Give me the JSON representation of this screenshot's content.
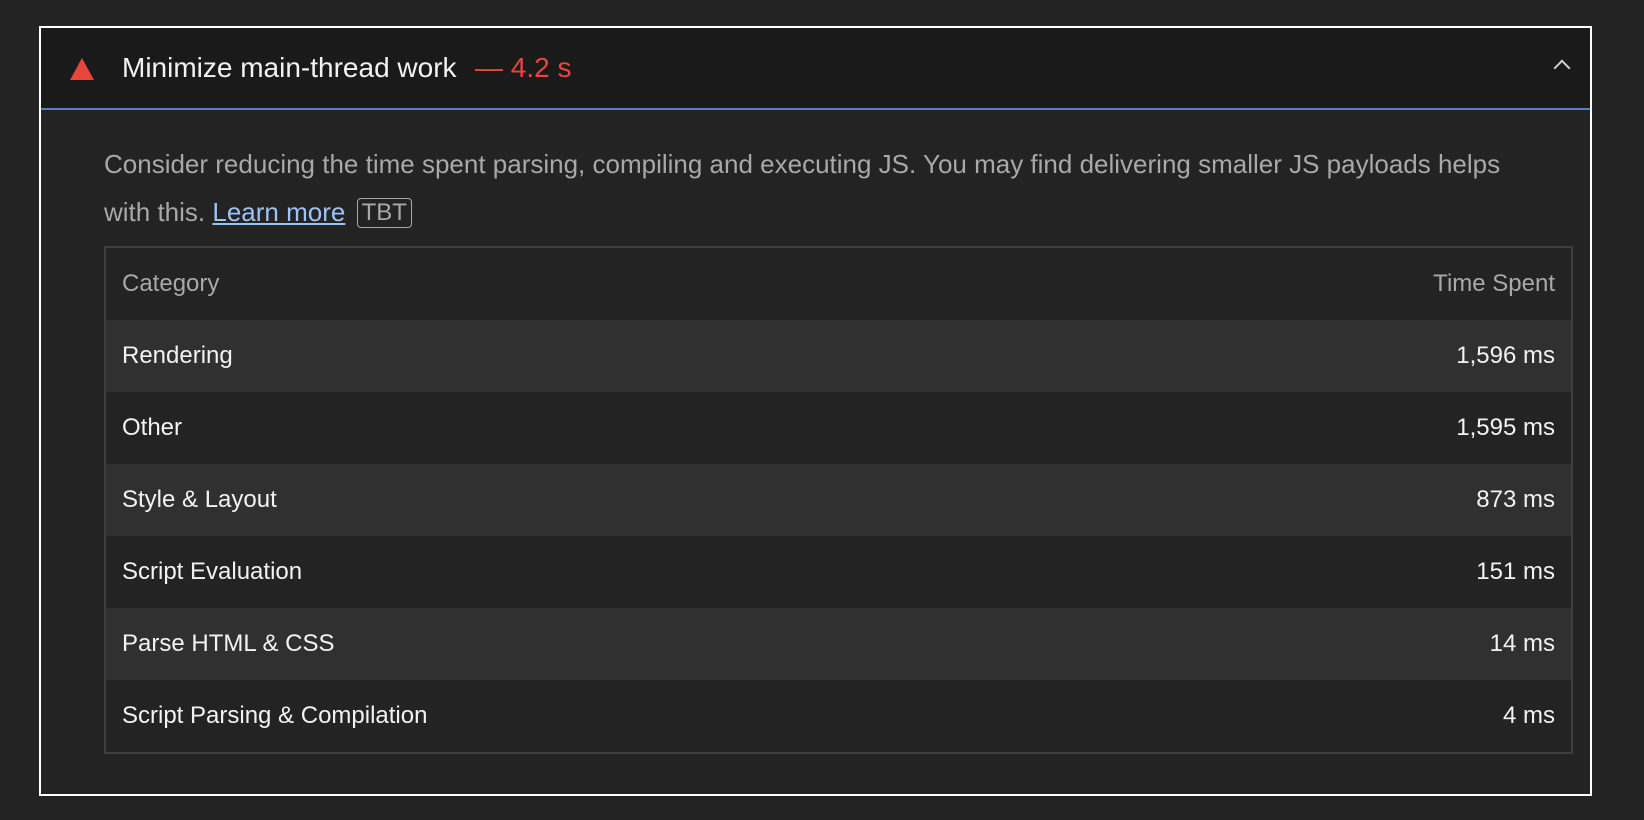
{
  "audit": {
    "title": "Minimize main-thread work",
    "display_value": "— 4.2 s",
    "status": "fail",
    "status_color": "#e8453c",
    "expanded": true,
    "description_text": "Consider reducing the time spent parsing, compiling and executing JS. You may find delivering smaller JS payloads helps with this.",
    "learn_more_label": "Learn more",
    "tag_label": "TBT"
  },
  "table": {
    "headers": [
      "Category",
      "Time Spent"
    ],
    "rows": [
      {
        "category": "Rendering",
        "time": "1,596 ms"
      },
      {
        "category": "Other",
        "time": "1,595 ms"
      },
      {
        "category": "Style & Layout",
        "time": "873 ms"
      },
      {
        "category": "Script Evaluation",
        "time": "151 ms"
      },
      {
        "category": "Parse HTML & CSS",
        "time": "14 ms"
      },
      {
        "category": "Script Parsing & Compilation",
        "time": "4 ms"
      }
    ]
  },
  "icons": {
    "status": "warning-triangle-icon",
    "toggle": "chevron-up-icon"
  },
  "colors": {
    "accent_line": "#4f7fd0",
    "link": "#9cc3f5",
    "background": "#232323"
  }
}
